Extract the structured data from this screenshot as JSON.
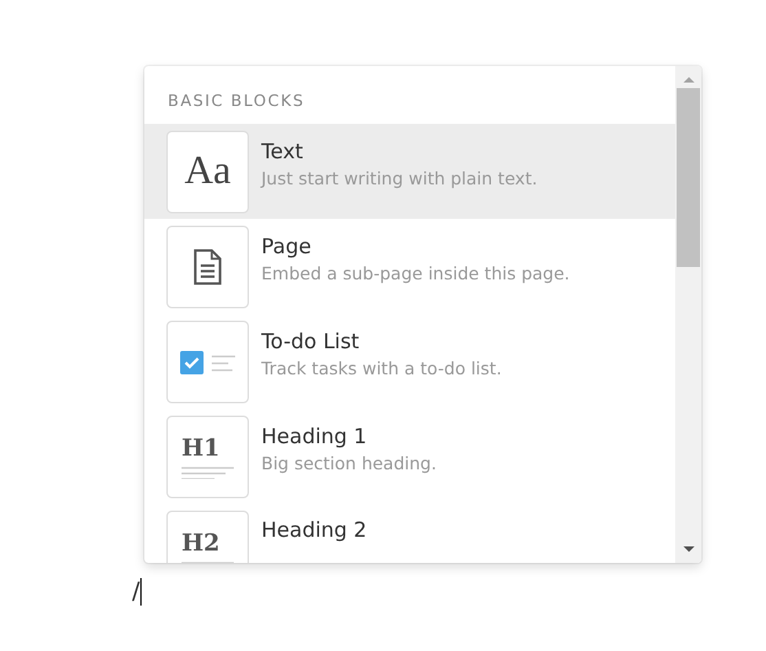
{
  "menu": {
    "section_title": "BASIC BLOCKS",
    "items": [
      {
        "kind": "glyph",
        "icon_text": "Aa",
        "title": "Text",
        "description": "Just start writing with plain text.",
        "selected": true
      },
      {
        "kind": "page",
        "title": "Page",
        "description": "Embed a sub-page inside this page.",
        "selected": false
      },
      {
        "kind": "todo",
        "title": "To-do List",
        "description": "Track tasks with a to-do list.",
        "selected": false
      },
      {
        "kind": "heading",
        "icon_text": "H1",
        "title": "Heading 1",
        "description": "Big section heading.",
        "selected": false
      },
      {
        "kind": "heading",
        "icon_text": "H2",
        "title": "Heading 2",
        "selected": false
      }
    ]
  },
  "editor": {
    "typed_text": "/"
  }
}
